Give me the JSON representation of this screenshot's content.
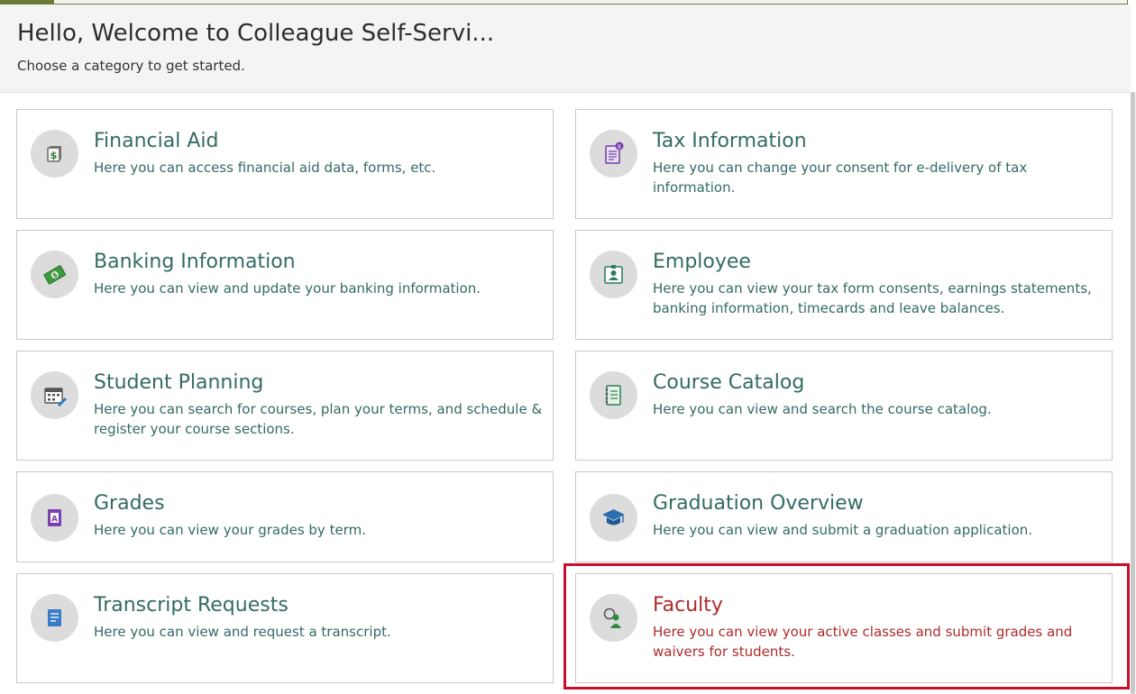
{
  "header": {
    "title": "Hello, Welcome to Colleague Self-Servi...",
    "subtitle": "Choose a category to get started."
  },
  "cards": [
    {
      "title": "Financial Aid",
      "description": "Here you can access financial aid data, forms, etc.",
      "icon": "financial-aid-icon"
    },
    {
      "title": "Tax Information",
      "description": "Here you can change your consent for e-delivery of tax information.",
      "icon": "tax-document-icon"
    },
    {
      "title": "Banking Information",
      "description": "Here you can view and update your banking information.",
      "icon": "money-icon"
    },
    {
      "title": "Employee",
      "description": "Here you can view your tax form consents, earnings statements, banking information, timecards and leave balances.",
      "icon": "id-badge-icon"
    },
    {
      "title": "Student Planning",
      "description": "Here you can search for courses, plan your terms, and schedule & register your course sections.",
      "icon": "calendar-icon"
    },
    {
      "title": "Course Catalog",
      "description": "Here you can view and search the course catalog.",
      "icon": "notebook-icon"
    },
    {
      "title": "Grades",
      "description": "Here you can view your grades by term.",
      "icon": "grade-a-icon"
    },
    {
      "title": "Graduation Overview",
      "description": "Here you can view and submit a graduation application.",
      "icon": "graduation-cap-icon"
    },
    {
      "title": "Transcript Requests",
      "description": "Here you can view and request a transcript.",
      "icon": "transcript-icon"
    },
    {
      "title": "Faculty",
      "description": "Here you can view your active classes and submit grades and waivers for students.",
      "icon": "faculty-icon"
    }
  ],
  "colors": {
    "title_text": "#336b63",
    "selected_text": "#b02a2a",
    "highlight_border": "#c8102e",
    "header_bg": "#f4f4f4",
    "icon_circle": "#dcdcdc"
  }
}
